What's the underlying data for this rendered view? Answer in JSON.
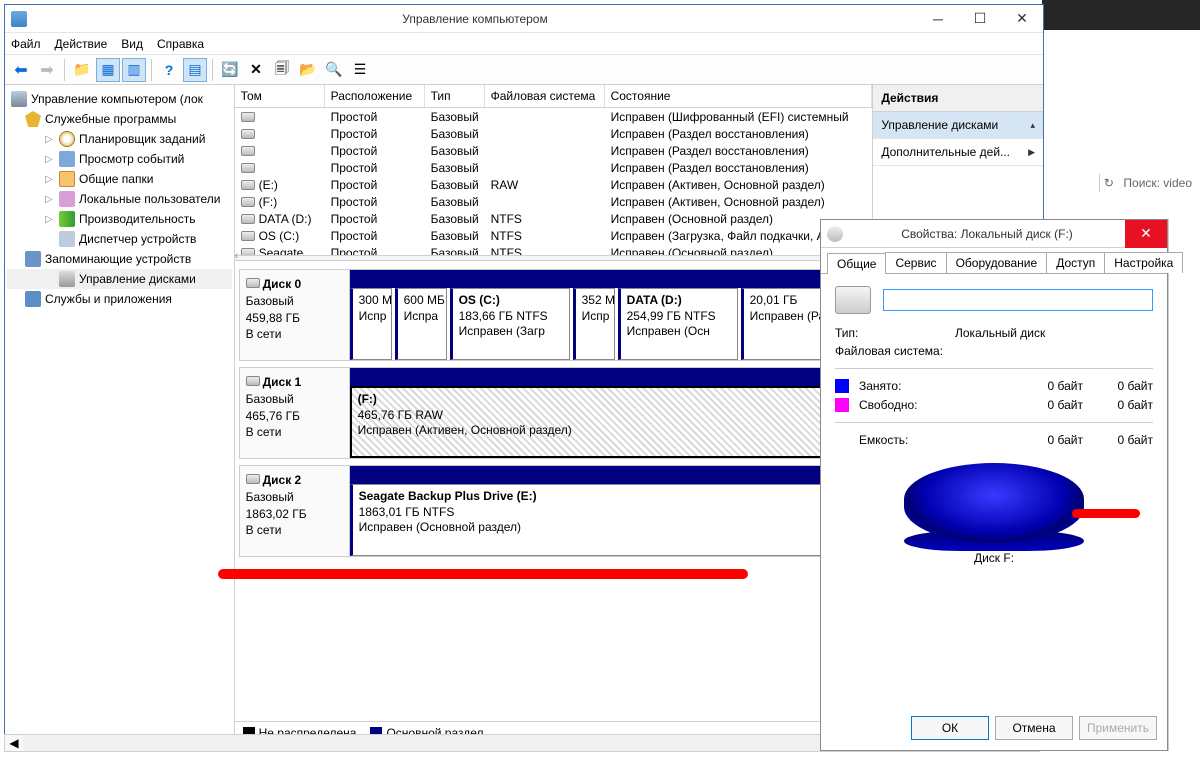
{
  "window": {
    "title": "Управление компьютером",
    "menu": [
      "Файл",
      "Действие",
      "Вид",
      "Справка"
    ]
  },
  "tree": {
    "root": "Управление компьютером (лок",
    "tools": "Служебные программы",
    "tasks": "Планировщик заданий",
    "events": "Просмотр событий",
    "folders": "Общие папки",
    "users": "Локальные пользователи",
    "perf": "Производительность",
    "devices": "Диспетчер устройств",
    "storage": "Запоминающие устройств",
    "disks": "Управление дисками",
    "services": "Службы и приложения"
  },
  "cols": {
    "c1": "Том",
    "c2": "Расположение",
    "c3": "Тип",
    "c4": "Файловая система",
    "c5": "Состояние"
  },
  "rows": [
    {
      "n": "",
      "l": "Простой",
      "t": "Базовый",
      "f": "",
      "s": "Исправен (Шифрованный (EFI) системный"
    },
    {
      "n": "",
      "l": "Простой",
      "t": "Базовый",
      "f": "",
      "s": "Исправен (Раздел восстановления)"
    },
    {
      "n": "",
      "l": "Простой",
      "t": "Базовый",
      "f": "",
      "s": "Исправен (Раздел восстановления)"
    },
    {
      "n": "",
      "l": "Простой",
      "t": "Базовый",
      "f": "",
      "s": "Исправен (Раздел восстановления)"
    },
    {
      "n": "(E:)",
      "l": "Простой",
      "t": "Базовый",
      "f": "RAW",
      "s": "Исправен (Активен, Основной раздел)"
    },
    {
      "n": "(F:)",
      "l": "Простой",
      "t": "Базовый",
      "f": "",
      "s": "Исправен (Активен, Основной раздел)"
    },
    {
      "n": "DATA (D:)",
      "l": "Простой",
      "t": "Базовый",
      "f": "NTFS",
      "s": "Исправен (Основной раздел)"
    },
    {
      "n": "OS (C:)",
      "l": "Простой",
      "t": "Базовый",
      "f": "NTFS",
      "s": "Исправен (Загрузка, Файл подкачки, Ав"
    },
    {
      "n": "Seagate ...",
      "l": "Простой",
      "t": "Базовый",
      "f": "NTFS",
      "s": "Исправен (Основной раздел)"
    }
  ],
  "d0": {
    "name": "Диск 0",
    "type": "Базовый",
    "size": "459,88 ГБ",
    "online": "В сети",
    "p": [
      {
        "t": "",
        "sz": "300 М",
        "st": "Испр"
      },
      {
        "t": "",
        "sz": "600 МБ",
        "st": "Испра"
      },
      {
        "t": "OS  (C:)",
        "sz": "183,66 ГБ NTFS",
        "st": "Исправен (Загр"
      },
      {
        "t": "",
        "sz": "352 М",
        "st": "Испр"
      },
      {
        "t": "DATA  (D:)",
        "sz": "254,99 ГБ NTFS",
        "st": "Исправен  (Осн"
      },
      {
        "t": "",
        "sz": "20,01 ГБ",
        "st": "Исправен (Раздел в"
      }
    ]
  },
  "d1": {
    "name": "Диск 1",
    "type": "Базовый",
    "size": "465,76 ГБ",
    "online": "В сети",
    "p": {
      "t": "(F:)",
      "sz": "465,76 ГБ RAW",
      "st": "Исправен (Активен, Основной раздел)"
    }
  },
  "d2": {
    "name": "Диск 2",
    "type": "Базовый",
    "size": "1863,02 ГБ",
    "online": "В сети",
    "p": {
      "t": "Seagate Backup Plus Drive  (E:)",
      "sz": "1863,01 ГБ NTFS",
      "st": "Исправен (Основной раздел)"
    }
  },
  "legend": {
    "unalloc": "Не распределена",
    "primary": "Основной раздел"
  },
  "actions": {
    "head": "Действия",
    "a1": "Управление дисками",
    "a2": "Дополнительные дей..."
  },
  "dialog": {
    "title": "Свойства: Локальный диск (F:)",
    "tabs": [
      "Общие",
      "Сервис",
      "Оборудование",
      "Доступ",
      "Настройка"
    ],
    "type_k": "Тип:",
    "type_v": "Локальный диск",
    "fs_k": "Файловая система:",
    "fs_v": "",
    "used": "Занято:",
    "free": "Свободно:",
    "cap": "Емкость:",
    "b0": "0 байт",
    "pielabel": "Диск F:",
    "ok": "ОК",
    "cancel": "Отмена",
    "apply": "Применить"
  },
  "bg": {
    "search": "Поиск: video"
  }
}
